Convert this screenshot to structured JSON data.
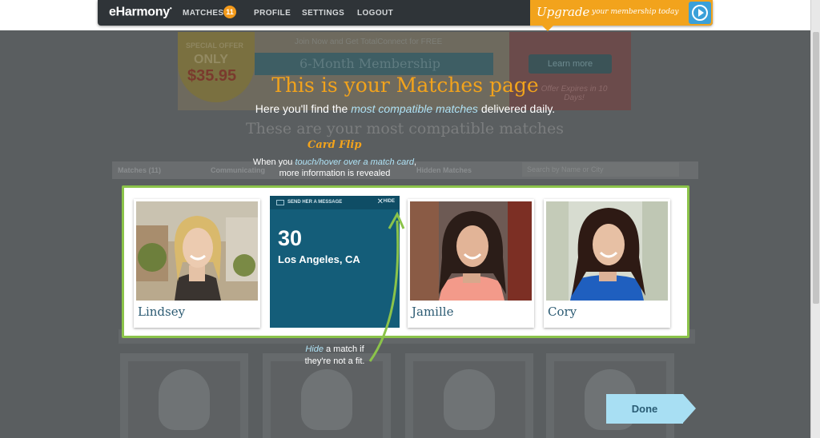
{
  "nav": {
    "logo": "eHarmony",
    "matches": "MATCHES",
    "matches_count": "11",
    "profile": "PROFILE",
    "settings": "SETTINGS",
    "logout": "LOGOUT",
    "upgrade": "Upgrade",
    "upgrade_sub": "your membership today"
  },
  "background": {
    "offer_special": "SPECIAL OFFER",
    "offer_only": "ONLY",
    "offer_price": "$35.95",
    "offer_top": "Join Now and Get TotalConnect for FREE",
    "offer_membership": "6-Month Membership",
    "learn_more": "Learn more",
    "offer_expires": "Offer Expires in 10 Days!",
    "heading": "These are your most compatible matches",
    "tabs": {
      "matches": "Matches (11)",
      "communicating": "Communicating",
      "hidden": "Hidden Matches"
    },
    "search_placeholder": "Search by Name or City"
  },
  "overlay": {
    "title": "This is your Matches page",
    "subtitle_pre": "Here you'll find the ",
    "subtitle_hl": "most compatible matches",
    "subtitle_post": " delivered daily.",
    "card_flip_title": "Card Flip",
    "flip_pre": "When you ",
    "flip_hl": "touch/hover over a match card",
    "flip_post": ",",
    "flip_line2": "more information is revealed",
    "hide_hl": "Hide",
    "hide_post": " a match if",
    "hide_line2": "they're not a fit."
  },
  "cards": {
    "card1": {
      "name": "Lindsey"
    },
    "flip": {
      "send_message": "SEND HER A MESSAGE",
      "hide": "HIDE",
      "age": "30",
      "location": "Los Angeles, CA"
    },
    "card3": {
      "name": "Jamille"
    },
    "card4": {
      "name": "Cory"
    }
  },
  "done_button": "Done",
  "colors": {
    "accent_orange": "#f2a31c",
    "highlight_green": "#8bc34a",
    "flip_blue": "#145d79",
    "done_blue": "#a8dff3"
  }
}
